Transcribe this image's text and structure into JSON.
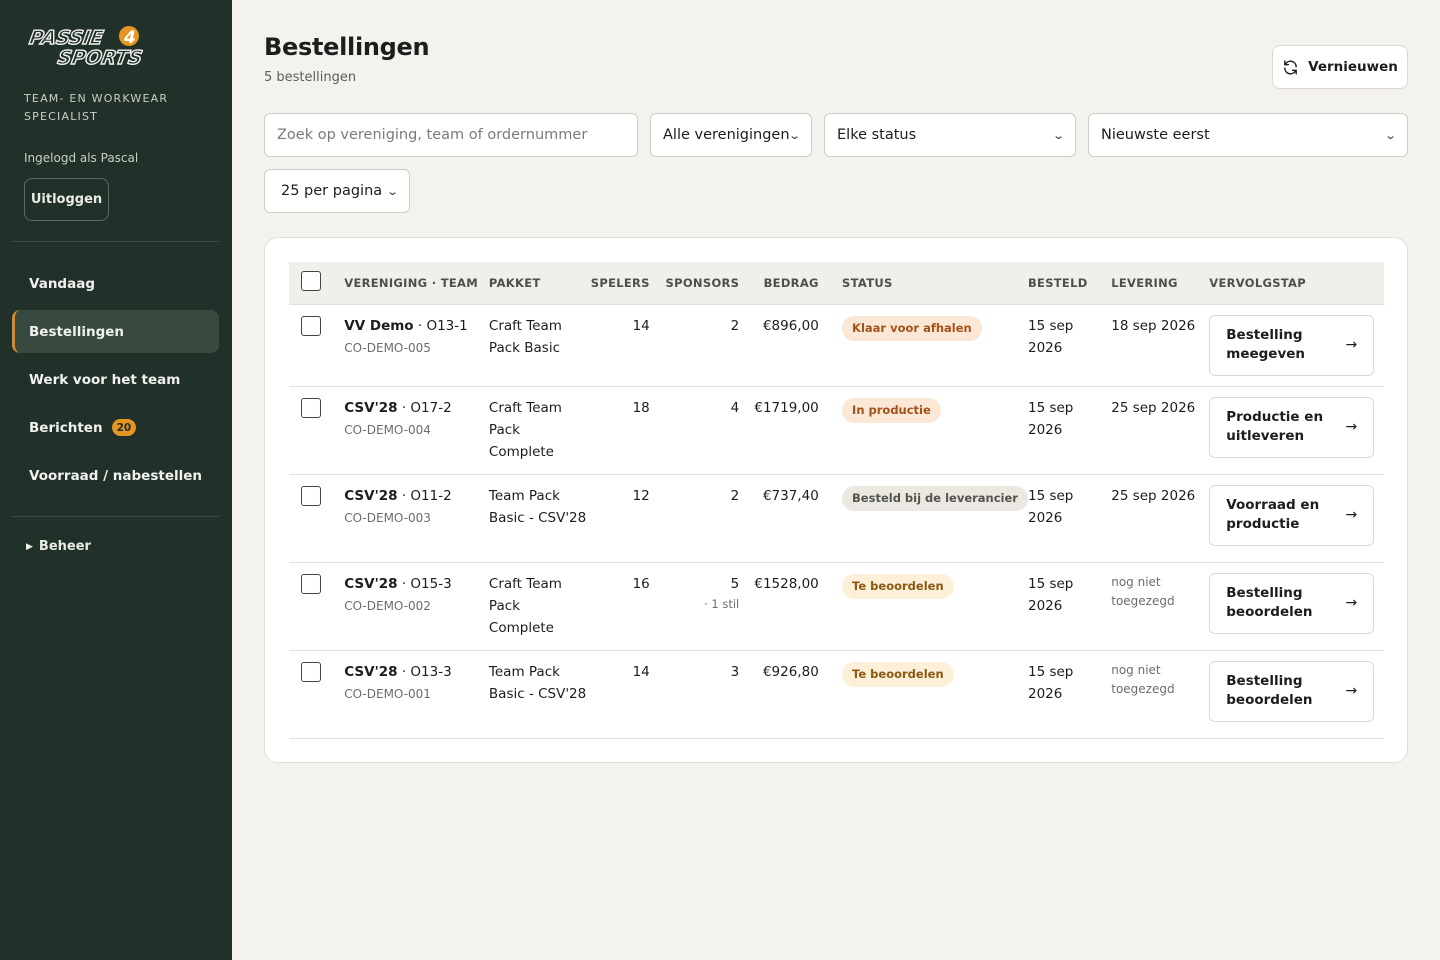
{
  "sidebar": {
    "logo_top": "PASSIE",
    "logo_num": "4",
    "logo_bottom": "SPORTS",
    "tagline": "Team- en workwear specialist",
    "logged_in": "Ingelogd als Pascal",
    "logout_label": "Uitloggen",
    "nav": [
      {
        "label": "Vandaag",
        "active": false
      },
      {
        "label": "Bestellingen",
        "active": true
      },
      {
        "label": "Werk voor het team",
        "active": false
      },
      {
        "label": "Berichten",
        "active": false,
        "badge": "20"
      },
      {
        "label": "Voorraad / nabestellen",
        "active": false
      }
    ],
    "beheer_label": "Beheer",
    "accent": "#d98a25"
  },
  "header": {
    "title": "Bestellingen",
    "count": "5 bestellingen",
    "refresh_label": "Vernieuwen"
  },
  "filters": {
    "search_placeholder": "Zoek op vereniging, team of ordernummer",
    "club": "Alle verenigingen",
    "status": "Elke status",
    "sort": "Nieuwste eerst",
    "per_page": "25 per pagina"
  },
  "table": {
    "headers": {
      "team": "Vereniging · Team",
      "package": "Pakket",
      "players": "Spelers",
      "sponsors": "Sponsors",
      "amount": "Bedrag",
      "status": "Status",
      "ordered": "Besteld",
      "delivery": "Levering",
      "next": "Vervolgstap"
    },
    "rows": [
      {
        "club": "VV Demo",
        "team": "O13-1",
        "code": "CO-DEMO-005",
        "package": "Craft Team Pack Basic",
        "players": "14",
        "sponsors": "2",
        "sponsor_note": "",
        "amount": "€896,00",
        "status": "Klaar voor afhalen",
        "status_bg": "#fbe7d6",
        "status_fg": "#a3521a",
        "ordered": "15 sep 2026",
        "delivery": "18 sep 2026",
        "delivery_muted": false,
        "next": "Bestelling meegeven"
      },
      {
        "club": "CSV'28",
        "team": "O17-2",
        "code": "CO-DEMO-004",
        "package": "Craft Team Pack Complete",
        "players": "18",
        "sponsors": "4",
        "sponsor_note": "",
        "amount": "€1719,00",
        "status": "In productie",
        "status_bg": "#fbe7d6",
        "status_fg": "#a3521a",
        "ordered": "15 sep 2026",
        "delivery": "25 sep 2026",
        "delivery_muted": false,
        "next": "Productie en uitleveren"
      },
      {
        "club": "CSV'28",
        "team": "O11-2",
        "code": "CO-DEMO-003",
        "package": "Team Pack Basic - CSV'28",
        "players": "12",
        "sponsors": "2",
        "sponsor_note": "",
        "amount": "€737,40",
        "status": "Besteld bij de leverancier",
        "status_bg": "#ebe8e2",
        "status_fg": "#54544f",
        "ordered": "15 sep 2026",
        "delivery": "25 sep 2026",
        "delivery_muted": false,
        "next": "Voorraad en productie"
      },
      {
        "club": "CSV'28",
        "team": "O15-3",
        "code": "CO-DEMO-002",
        "package": "Craft Team Pack Complete",
        "players": "16",
        "sponsors": "5",
        "sponsor_note": "· 1 stil",
        "amount": "€1528,00",
        "status": "Te beoordelen",
        "status_bg": "#fdf0d8",
        "status_fg": "#8a5a12",
        "ordered": "15 sep 2026",
        "delivery": "nog niet toegezegd",
        "delivery_muted": true,
        "next": "Bestelling beoordelen"
      },
      {
        "club": "CSV'28",
        "team": "O13-3",
        "code": "CO-DEMO-001",
        "package": "Team Pack Basic - CSV'28",
        "players": "14",
        "sponsors": "3",
        "sponsor_note": "",
        "amount": "€926,80",
        "status": "Te beoordelen",
        "status_bg": "#fdf0d8",
        "status_fg": "#8a5a12",
        "ordered": "15 sep 2026",
        "delivery": "nog niet toegezegd",
        "delivery_muted": true,
        "next": "Bestelling beoordelen"
      }
    ]
  }
}
